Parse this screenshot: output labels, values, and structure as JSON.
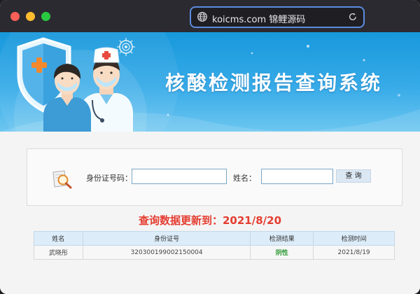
{
  "browser": {
    "url": "koicms.com 锦鲤源码",
    "controls": {
      "close_color": "#fe5f57",
      "minimize_color": "#febc2e",
      "zoom_color": "#28c840"
    }
  },
  "banner": {
    "title": "核酸检测报告查询系统",
    "illustration": "doctor-nurse-shield-illustration",
    "colors": {
      "top": "#1798dc",
      "bottom": "#6cc6f0"
    }
  },
  "search": {
    "icon": "magnifier-document-icon",
    "id_label": "身份证号码：",
    "id_value": "",
    "name_label": "姓名：",
    "name_value": "",
    "query_button": "查 询"
  },
  "update_notice": "查询数据更新到：2021/8/20",
  "results": {
    "headers": [
      "姓名",
      "身份证号",
      "检测结果",
      "检测时间"
    ],
    "rows": [
      [
        "武晓彤",
        "320300199002150004",
        "阴性",
        "2021/8/19"
      ]
    ]
  }
}
